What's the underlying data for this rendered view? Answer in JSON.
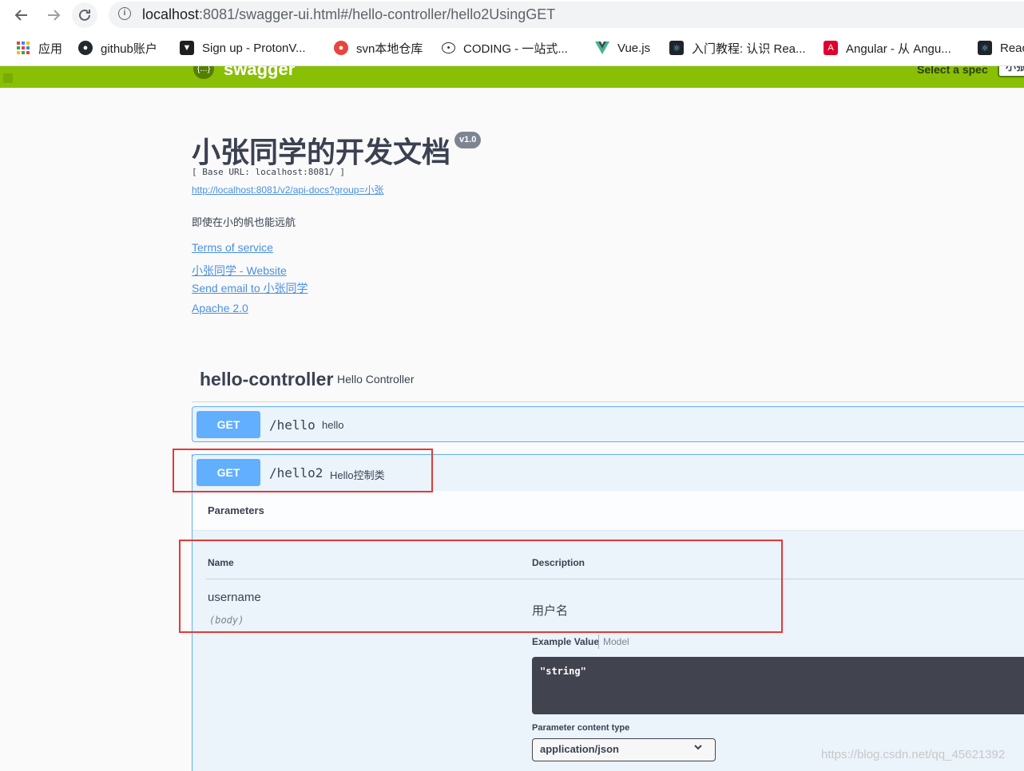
{
  "browser": {
    "url_host": "localhost",
    "url_rest": ":8081/swagger-ui.html#/hello-controller/hello2UsingGET",
    "bookmarks": [
      {
        "label": "应用",
        "icon": "apps-grid-icon",
        "color": "#4285f4"
      },
      {
        "label": "github账户",
        "icon": "github-icon",
        "color": "#24292e"
      },
      {
        "label": "Sign up - ProtonV...",
        "icon": "protonvpn-icon",
        "color": "#1f1f1f"
      },
      {
        "label": "svn本地仓库",
        "icon": "svn-icon",
        "color": "#e8453c"
      },
      {
        "label": "CODING - 一站式...",
        "icon": "coding-icon",
        "color": "#333333"
      },
      {
        "label": "Vue.js",
        "icon": "vue-icon",
        "color": "#41b883"
      },
      {
        "label": "入门教程: 认识 Rea...",
        "icon": "react-icon",
        "color": "#20232a"
      },
      {
        "label": "Angular - 从 Angu...",
        "icon": "angular-icon",
        "color": "#dd0031"
      },
      {
        "label": "Reac",
        "icon": "react-icon",
        "color": "#20232a"
      }
    ]
  },
  "swagger": {
    "logo_text": "swagger",
    "spec_label": "Select a spec",
    "spec_value": "小张"
  },
  "info": {
    "title": "小张同学的开发文档",
    "version": "v1.0",
    "base_url": "[ Base URL: localhost:8081/ ]",
    "api_docs_link": "http://localhost:8081/v2/api-docs?group=小张",
    "description": "即使在小的帆也能远航",
    "terms": "Terms of service",
    "website": "小张同学 - Website",
    "email": "Send email to 小张同学",
    "license": "Apache 2.0"
  },
  "tag": {
    "name": "hello-controller",
    "description": "Hello Controller"
  },
  "operations": [
    {
      "method": "GET",
      "path": "/hello",
      "summary": "hello"
    },
    {
      "method": "GET",
      "path": "/hello2",
      "summary": "Hello控制类"
    }
  ],
  "parameters": {
    "title": "Parameters",
    "col_name": "Name",
    "col_description": "Description",
    "name": "username",
    "in": "(body)",
    "description": "用户名",
    "example_tab": "Example Value",
    "model_tab": "Model",
    "example_code": "\"string\"",
    "content_type_label": "Parameter content type",
    "content_type_value": "application/json"
  },
  "watermark": "https://blog.csdn.net/qq_45621392",
  "colors": {
    "topbar": "#89bf04",
    "get": "#61affe",
    "annotation": "#e53935"
  }
}
